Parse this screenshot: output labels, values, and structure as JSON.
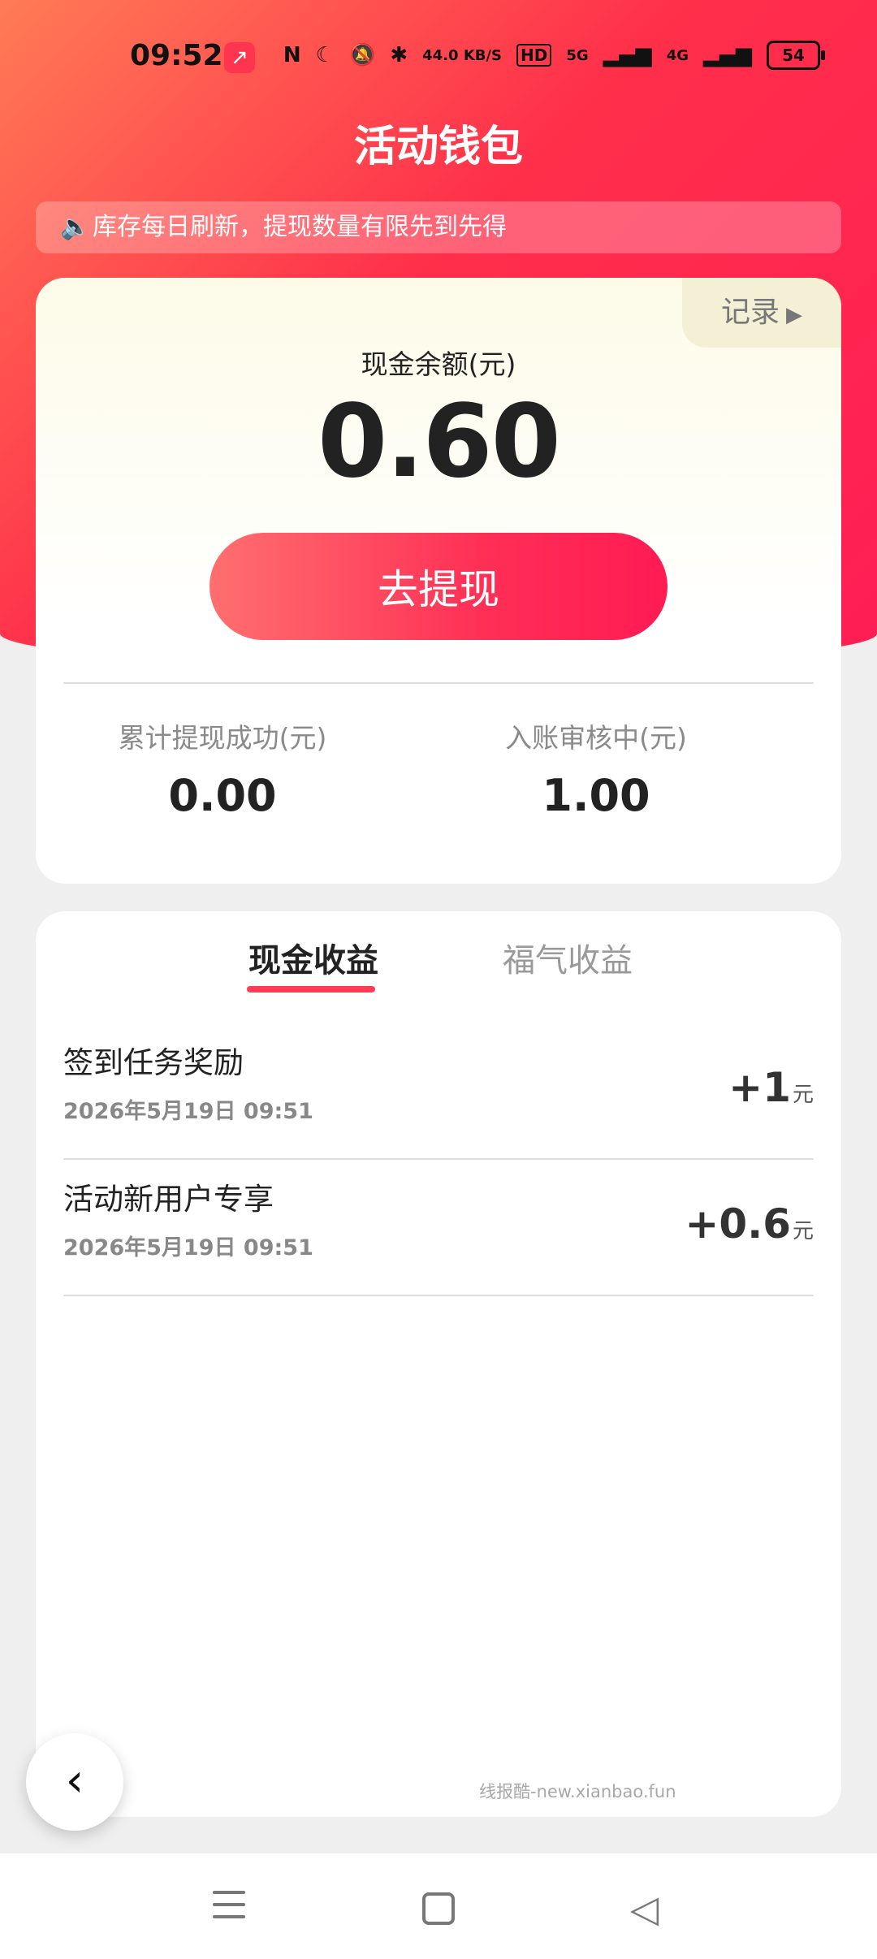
{
  "status_bar": {
    "time": "09:52",
    "app_icon_glyph": "↗",
    "network_speed": "44.0 KB/S",
    "hd_label": "HD",
    "net_5g": "5G",
    "net_4g": "4G",
    "battery": "54"
  },
  "header": {
    "title": "活动钱包",
    "notice": "库存每日刷新，提现数量有限先到先得"
  },
  "balance": {
    "record_label": "记录",
    "label": "现金余额(元)",
    "value": "0.60",
    "withdraw_button": "去提现",
    "total_withdrawn_label": "累计提现成功(元)",
    "total_withdrawn_value": "0.00",
    "pending_label": "入账审核中(元)",
    "pending_value": "1.00"
  },
  "tabs": [
    {
      "label": "现金收益",
      "active": true
    },
    {
      "label": "福气收益",
      "active": false
    }
  ],
  "records": [
    {
      "name": "签到任务奖励",
      "time": "2026年5月19日 09:51",
      "amount": "+1",
      "unit": "元"
    },
    {
      "name": "活动新用户专享",
      "time": "2026年5月19日 09:51",
      "amount": "+0.6",
      "unit": "元"
    }
  ],
  "watermark": "线报酷-new.xianbao.fun",
  "colors": {
    "accent": "#ff2f4a",
    "gradient_start": "#ff7b56",
    "card_top": "#fdfbe8"
  },
  "icons": {
    "back": "chevron-left-icon",
    "speaker": "speaker-icon"
  }
}
